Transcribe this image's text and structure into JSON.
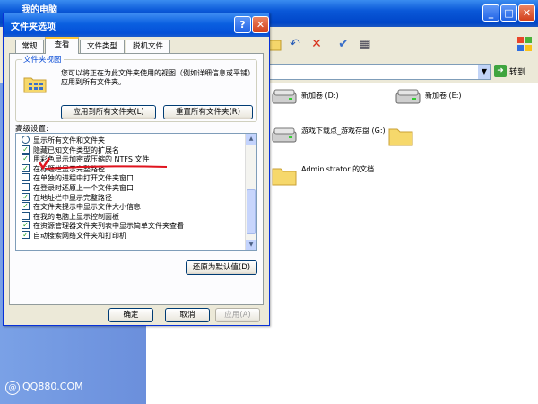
{
  "explorer": {
    "title": "我的电脑",
    "go_label": "转到",
    "drives": [
      {
        "label": "新加卷 (D:)"
      },
      {
        "label": "新加卷 (E:)"
      },
      {
        "label": "游戏下载点_游戏存盘 (G:)"
      },
      {
        "label": "Administrator 的文档"
      }
    ],
    "watermark": "QQ880.COM"
  },
  "dialog": {
    "title": "文件夹选项",
    "help_label": "?",
    "close_label": "✕",
    "tabs": [
      {
        "label": "常规"
      },
      {
        "label": "查看"
      },
      {
        "label": "文件类型"
      },
      {
        "label": "脱机文件"
      }
    ],
    "folder_view": {
      "legend": "文件夹视图",
      "description": "您可以将正在为此文件夹使用的视图（例如详细信息或平铺）应用到所有文件夹。",
      "apply_all": "应用到所有文件夹(L)",
      "reset_all": "重置所有文件夹(R)"
    },
    "advanced_label": "高级设置:",
    "advanced_items": [
      {
        "label": "显示所有文件和文件夹",
        "kind": "radio",
        "checked": false
      },
      {
        "label": "隐藏已知文件类型的扩展名",
        "kind": "check",
        "checked": true
      },
      {
        "label": "用彩色显示加密或压缩的 NTFS 文件",
        "kind": "check",
        "checked": true
      },
      {
        "label": "在标题栏显示完整路径",
        "kind": "check",
        "checked": true
      },
      {
        "label": "在单独的进程中打开文件夹窗口",
        "kind": "check",
        "checked": false
      },
      {
        "label": "在登录时还原上一个文件夹窗口",
        "kind": "check",
        "checked": false
      },
      {
        "label": "在地址栏中显示完整路径",
        "kind": "check",
        "checked": true
      },
      {
        "label": "在文件夹提示中显示文件大小信息",
        "kind": "check",
        "checked": true
      },
      {
        "label": "在我的电脑上显示控制面板",
        "kind": "check",
        "checked": false
      },
      {
        "label": "在资源管理器文件夹列表中显示简单文件夹查看",
        "kind": "check",
        "checked": true
      },
      {
        "label": "自动搜索网络文件夹和打印机",
        "kind": "check",
        "checked": true
      }
    ],
    "restore_defaults": "还原为默认值(D)",
    "ok": "确定",
    "cancel": "取消",
    "apply": "应用(A)"
  }
}
